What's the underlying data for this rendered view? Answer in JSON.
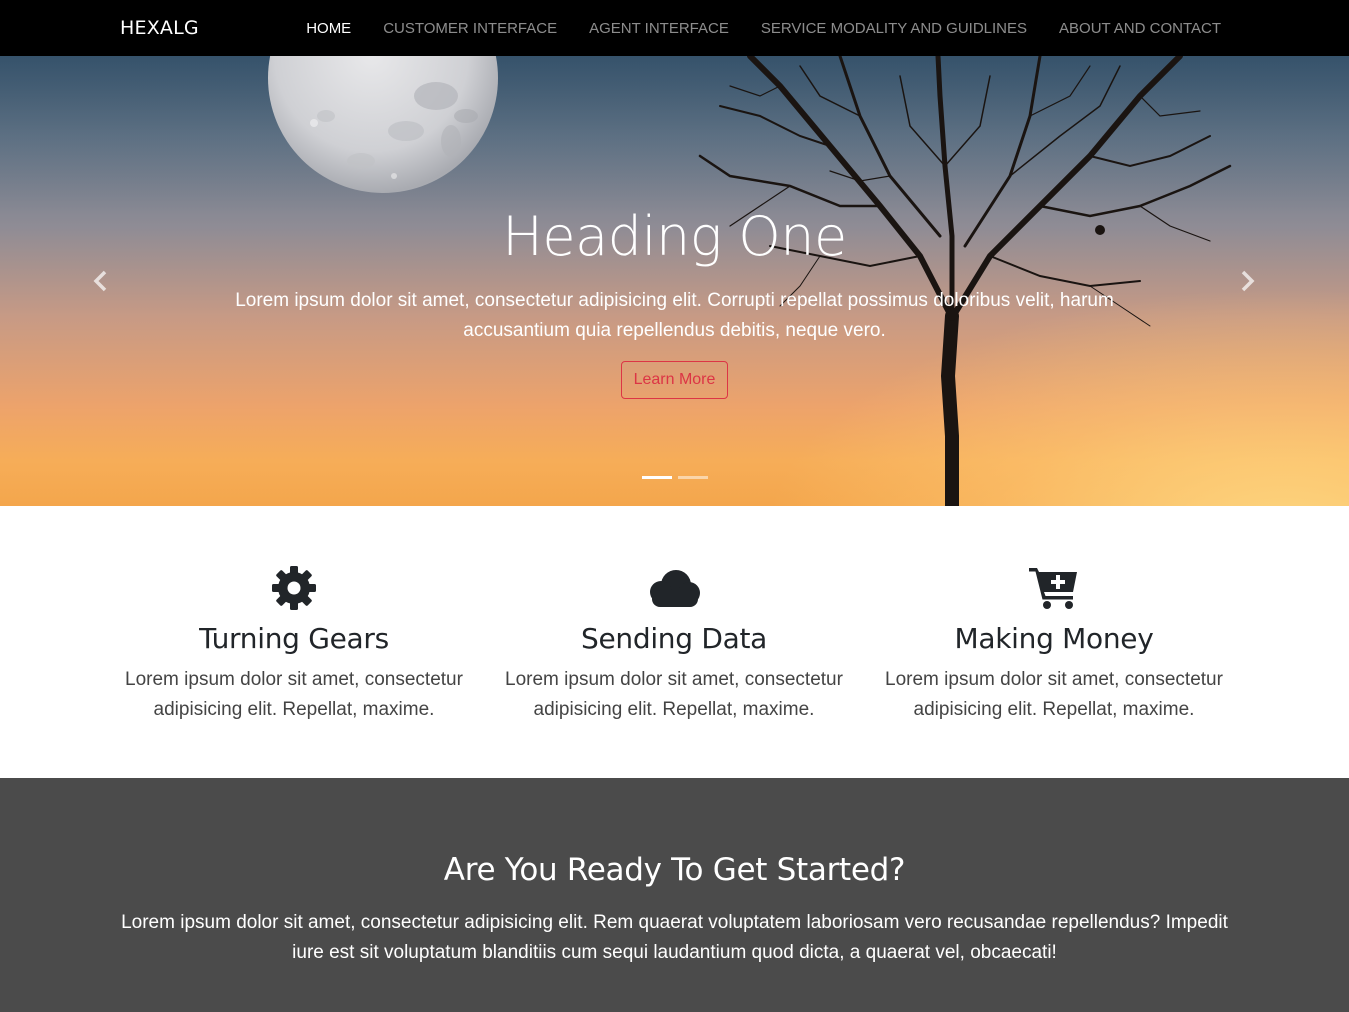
{
  "navbar": {
    "brand": "HEXALG",
    "links": [
      {
        "label": "HOME",
        "active": true
      },
      {
        "label": "CUSTOMER INTERFACE",
        "active": false
      },
      {
        "label": "AGENT INTERFACE",
        "active": false
      },
      {
        "label": "SERVICE MODALITY AND GUIDLINES",
        "active": false
      },
      {
        "label": "ABOUT AND CONTACT",
        "active": false
      }
    ]
  },
  "hero": {
    "heading": "Heading One",
    "text": "Lorem ipsum dolor sit amet, consectetur adipisicing elit. Corrupti repellat possimus doloribus velit, harum accusantium quia repellendus debitis, neque vero.",
    "button_label": "Learn More",
    "slide_count": 2,
    "active_slide": 1,
    "prev_icon": "chevron-left-icon",
    "next_icon": "chevron-right-icon"
  },
  "features": [
    {
      "icon": "gear-icon",
      "title": "Turning Gears",
      "text": "Lorem ipsum dolor sit amet, consectetur adipisicing elit. Repellat, maxime."
    },
    {
      "icon": "cloud-icon",
      "title": "Sending Data",
      "text": "Lorem ipsum dolor sit amet, consectetur adipisicing elit. Repellat, maxime."
    },
    {
      "icon": "cart-plus-icon",
      "title": "Making Money",
      "text": "Lorem ipsum dolor sit amet, consectetur adipisicing elit. Repellat, maxime."
    }
  ],
  "cta": {
    "title": "Are You Ready To Get Started?",
    "text": "Lorem ipsum dolor sit amet, consectetur adipisicing elit. Rem quaerat voluptatem laboriosam vero recusandae repellendus? Impedit iure est sit voluptatum blanditiis cum sequi laudantium quod dicta, a quaerat vel, obcaecati!"
  },
  "colors": {
    "navbar_bg": "#000000",
    "button_accent": "#dc3545",
    "cta_bg": "#4b4b4b",
    "icon_color": "#212529"
  }
}
